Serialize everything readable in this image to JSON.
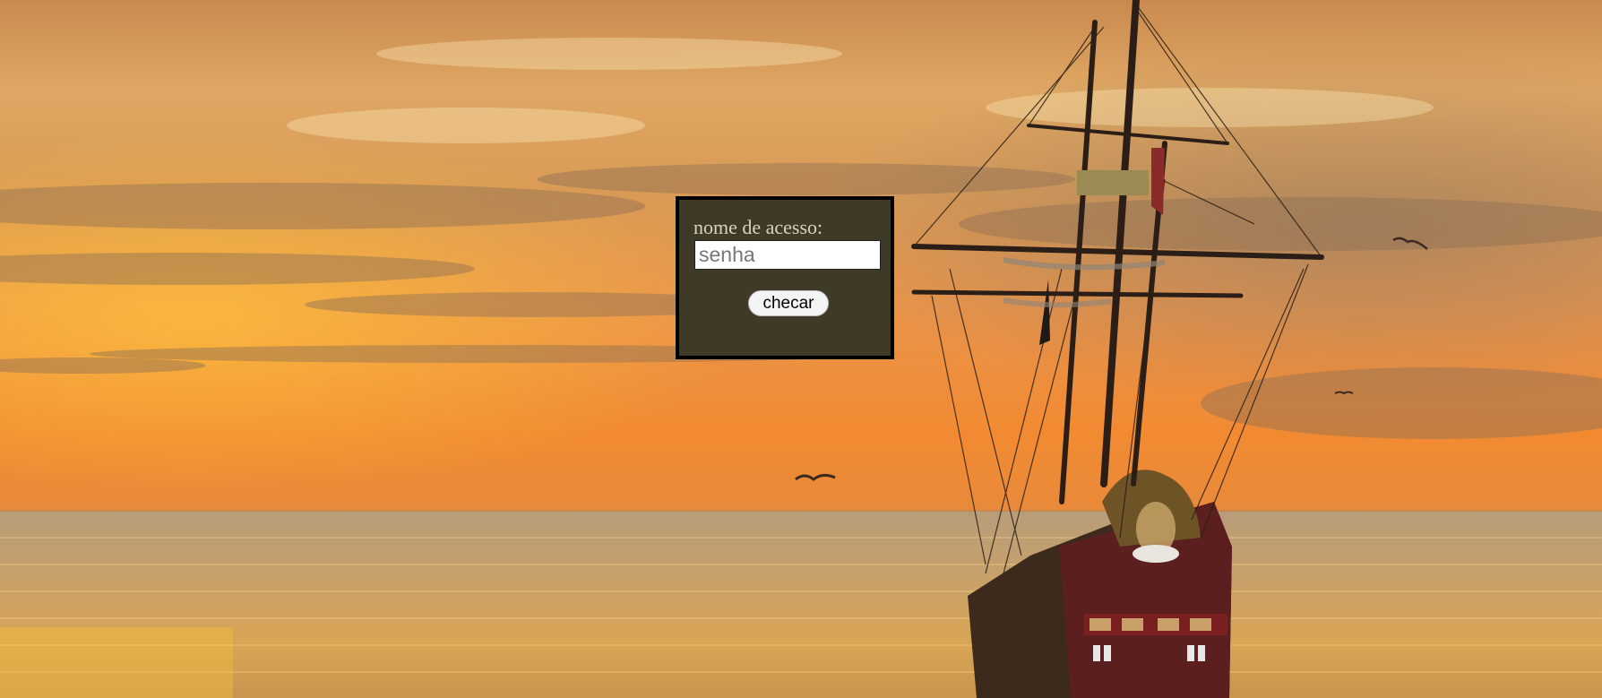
{
  "login_form": {
    "label": "nome de acesso:",
    "password_placeholder": "senha",
    "password_value": "",
    "submit_label": "checar"
  },
  "background": {
    "subject": "sailing ship at sunset over the sea",
    "colors": {
      "sky_top": "#c98a4e",
      "sky_mid": "#e7a253",
      "sky_low": "#f08a2a",
      "sea": "#c99a5f",
      "panel": "#3f3a28",
      "panel_border": "#000000"
    }
  }
}
